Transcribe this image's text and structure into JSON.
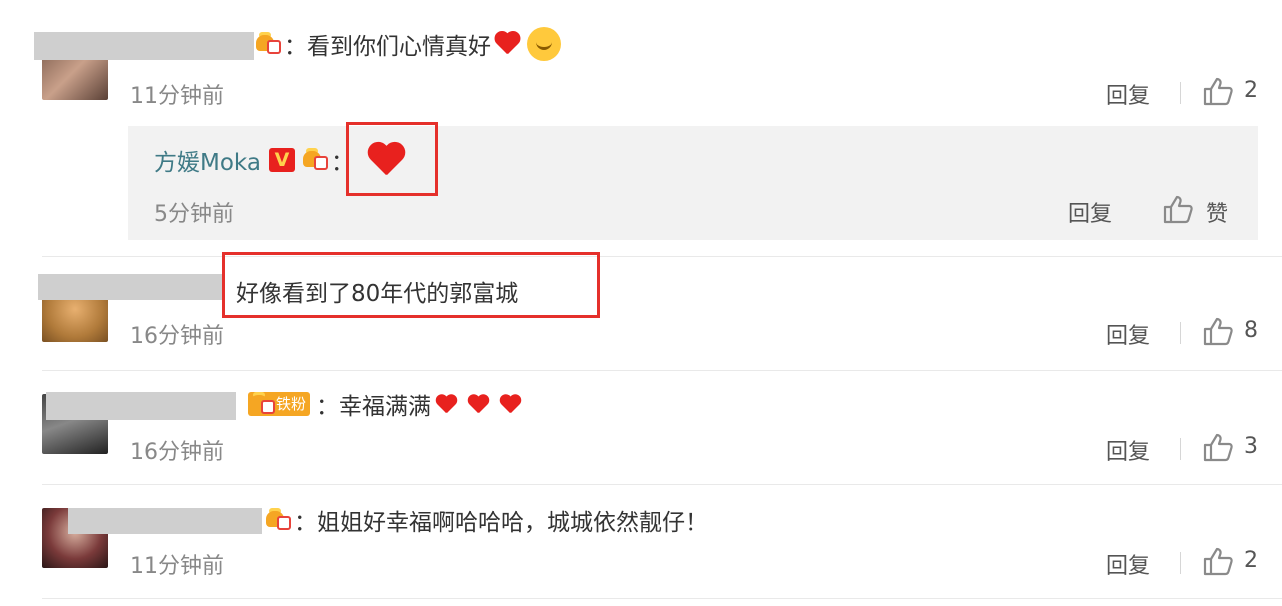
{
  "comments": [
    {
      "text": "：看到你们心情真好",
      "time": "11分钟前",
      "reply_label": "回复",
      "like_count": "2",
      "reply": {
        "author": "方媛Moka",
        "verified": "V",
        "text": "：",
        "time": "5分钟前",
        "reply_label": "回复",
        "like_label": "赞"
      }
    },
    {
      "text": "好像看到了80年代的郭富城",
      "time": "16分钟前",
      "reply_label": "回复",
      "like_count": "8"
    },
    {
      "badge": "铁粉",
      "text": "：幸福满满",
      "time": "16分钟前",
      "reply_label": "回复",
      "like_count": "3"
    },
    {
      "text": "：姐姐好幸福啊哈哈哈，城城依然靓仔！",
      "time": "11分钟前",
      "reply_label": "回复",
      "like_count": "2"
    }
  ],
  "colors": {
    "highlight_box": "#e5302b",
    "heart": "#e8211e",
    "author_link": "#3f7a86",
    "muted_text": "#888888"
  },
  "icons": [
    "member-crown-icon",
    "heart-emoji",
    "smile-emoji",
    "like-thumb-icon",
    "verified-v-badge"
  ]
}
